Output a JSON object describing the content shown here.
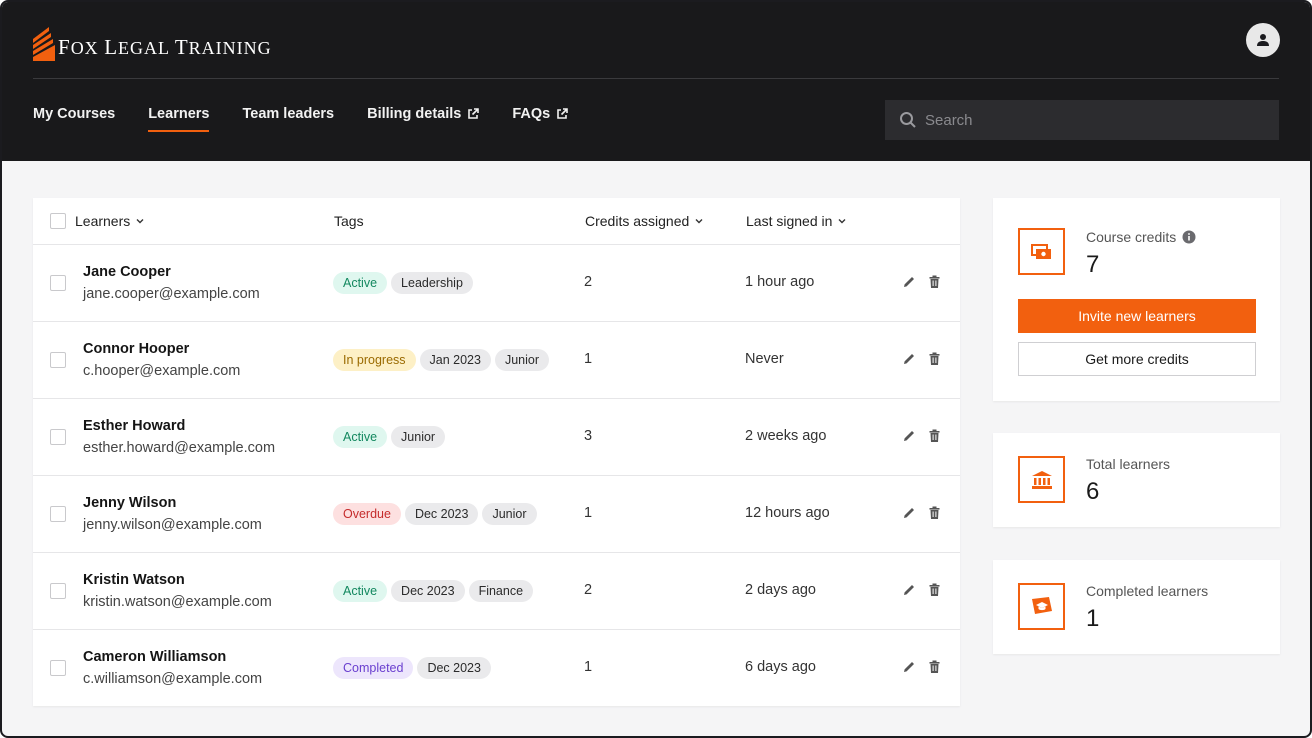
{
  "brand": {
    "name_first": "F",
    "name_rest": "OX ",
    "name_first2": "L",
    "name_rest2": "EGAL ",
    "name_first3": "T",
    "name_rest3": "RAINING",
    "accent": "#f2600f"
  },
  "nav": {
    "items": [
      {
        "label": "My Courses"
      },
      {
        "label": "Learners"
      },
      {
        "label": "Team leaders"
      },
      {
        "label": "Billing details"
      },
      {
        "label": "FAQs"
      }
    ]
  },
  "search": {
    "placeholder": "Search"
  },
  "table": {
    "headers": {
      "learners": "Learners",
      "tags": "Tags",
      "credits": "Credits assigned",
      "last_signed": "Last signed in"
    },
    "rows": [
      {
        "name": "Jane Cooper",
        "email": "jane.cooper@example.com",
        "status": "Active",
        "tags": [
          "Leadership"
        ],
        "credits": "2",
        "last_signed": "1 hour ago"
      },
      {
        "name": "Connor Hooper",
        "email": "c.hooper@example.com",
        "status": "In progress",
        "tags": [
          "Jan 2023",
          "Junior"
        ],
        "credits": "1",
        "last_signed": "Never"
      },
      {
        "name": "Esther Howard",
        "email": "esther.howard@example.com",
        "status": "Active",
        "tags": [
          "Junior"
        ],
        "credits": "3",
        "last_signed": "2 weeks ago"
      },
      {
        "name": "Jenny Wilson",
        "email": "jenny.wilson@example.com",
        "status": "Overdue",
        "tags": [
          "Dec 2023",
          "Junior"
        ],
        "credits": "1",
        "last_signed": "12 hours ago"
      },
      {
        "name": "Kristin Watson",
        "email": "kristin.watson@example.com",
        "status": "Active",
        "tags": [
          "Dec 2023",
          "Finance"
        ],
        "credits": "2",
        "last_signed": "2 days ago"
      },
      {
        "name": "Cameron Williamson",
        "email": "c.williamson@example.com",
        "status": "Completed",
        "tags": [
          "Dec 2023"
        ],
        "credits": "1",
        "last_signed": "6 days ago"
      }
    ]
  },
  "cards": {
    "course_credits": {
      "label": "Course credits",
      "value": "7",
      "invite_label": "Invite new learners",
      "more_label": "Get more credits"
    },
    "total_learners": {
      "label": "Total learners",
      "value": "6"
    },
    "completed_learners": {
      "label": "Completed learners",
      "value": "1"
    }
  }
}
